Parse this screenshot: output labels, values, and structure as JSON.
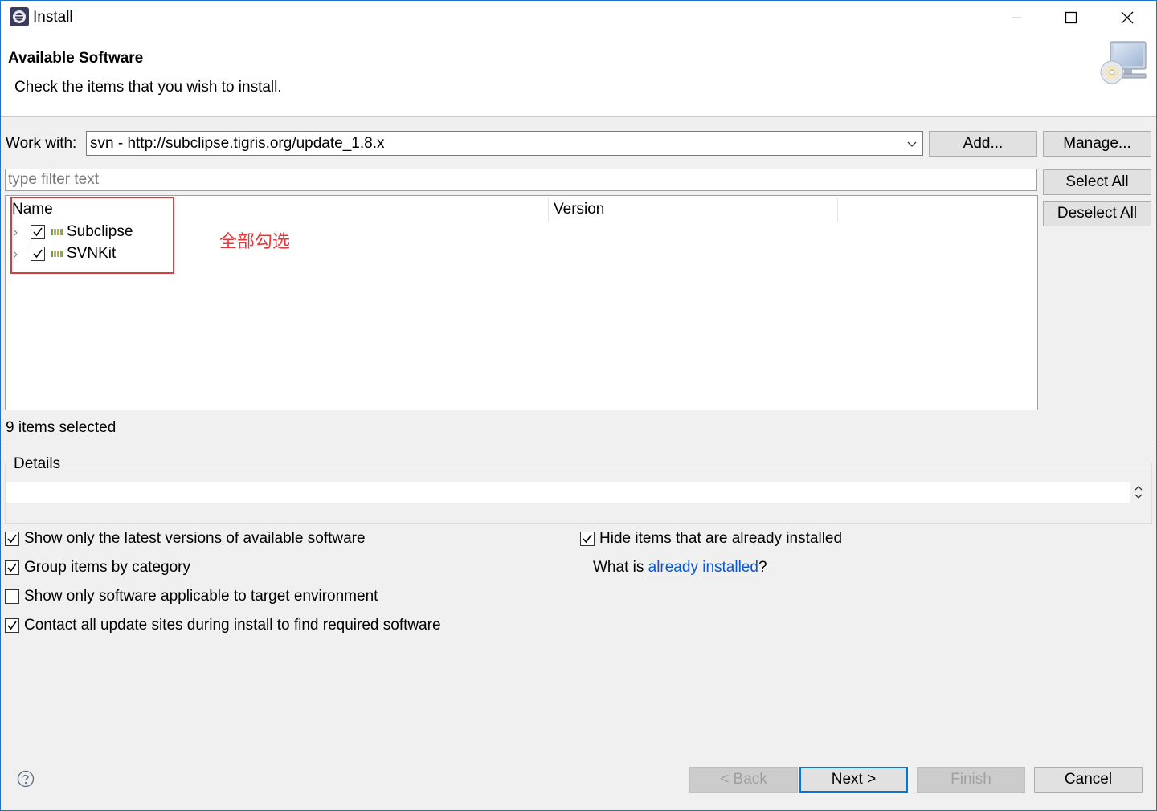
{
  "window": {
    "title": "Install",
    "controls": {
      "minimize": "minimize",
      "maximize": "maximize",
      "close": "close"
    }
  },
  "header": {
    "title": "Available Software",
    "description": "Check the items that you wish to install."
  },
  "work_with": {
    "label": "Work with:",
    "value": "svn - http://subclipse.tigris.org/update_1.8.x",
    "add_label": "Add...",
    "manage_label": "Manage..."
  },
  "filter": {
    "placeholder": "type filter text",
    "value": ""
  },
  "side_buttons": {
    "select_all": "Select All",
    "deselect_all": "Deselect All"
  },
  "tree": {
    "columns": [
      "Name",
      "Version"
    ],
    "items": [
      {
        "name": "Subclipse",
        "checked": true
      },
      {
        "name": "SVNKit",
        "checked": true
      }
    ]
  },
  "annotation": "全部勾选",
  "status": "9 items selected",
  "details": {
    "label": "Details",
    "text": ""
  },
  "options": {
    "latest_versions": {
      "label": "Show only the latest versions of available software",
      "checked": true
    },
    "group_by_category": {
      "label": "Group items by category",
      "checked": true
    },
    "target_env": {
      "label": "Show only software applicable to target environment",
      "checked": false
    },
    "contact_sites": {
      "label": "Contact all update sites during install to find required software",
      "checked": true
    },
    "hide_installed": {
      "label": "Hide items that are already installed",
      "checked": true
    },
    "what_is_prefix": "What is ",
    "what_is_link": "already installed",
    "what_is_suffix": "?"
  },
  "footer": {
    "back": "< Back",
    "next": "Next >",
    "finish": "Finish",
    "cancel": "Cancel"
  },
  "colors": {
    "accent": "#0078d7",
    "annotation": "#e03a3a",
    "link": "#0a58ca"
  }
}
